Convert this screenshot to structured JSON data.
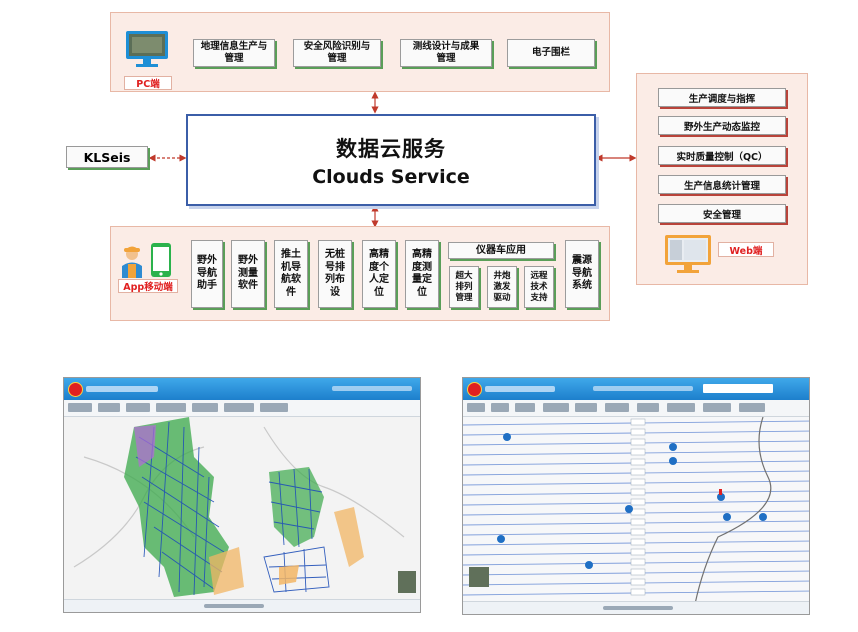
{
  "pc": {
    "label": "PC端",
    "items": [
      "地理信息生产与\n管理",
      "安全风险识别与\n管理",
      "测线设计与成果\n管理",
      "电子围栏"
    ]
  },
  "cloud": {
    "cn": "数据云服务",
    "en": "Clouds Service"
  },
  "klseis": "KLSeis",
  "web": {
    "label": "Web端",
    "items": [
      "生产调度与指挥",
      "野外生产动态监控",
      "实时质量控制（QC）",
      "生产信息统计管理",
      "安全管理"
    ]
  },
  "app": {
    "label": "App移动端",
    "items": [
      "野外\n导航\n助手",
      "野外\n测量\n软件",
      "推土\n机导\n航软\n件",
      "无桩\n号排\n列布\n设",
      "高精\n度个\n人定\n位",
      "高精\n度测\n量定\n位"
    ],
    "instrument": {
      "title": "仪器车应用",
      "items": [
        "超大\n排列\n管理",
        "井炮\n激发\n驱动",
        "远程\n技术\n支持"
      ]
    },
    "last": "震源\n导航\n系统"
  },
  "colors": {
    "green_shadow": "#5a9e58",
    "red_shadow": "#b8433a",
    "panel_bg": "#fbece6",
    "cloud_border": "#3b5ea8",
    "label_red": "#e02020"
  },
  "icons": [
    "monitor-icon",
    "worker-icon",
    "phone-icon",
    "arrow-icon"
  ]
}
